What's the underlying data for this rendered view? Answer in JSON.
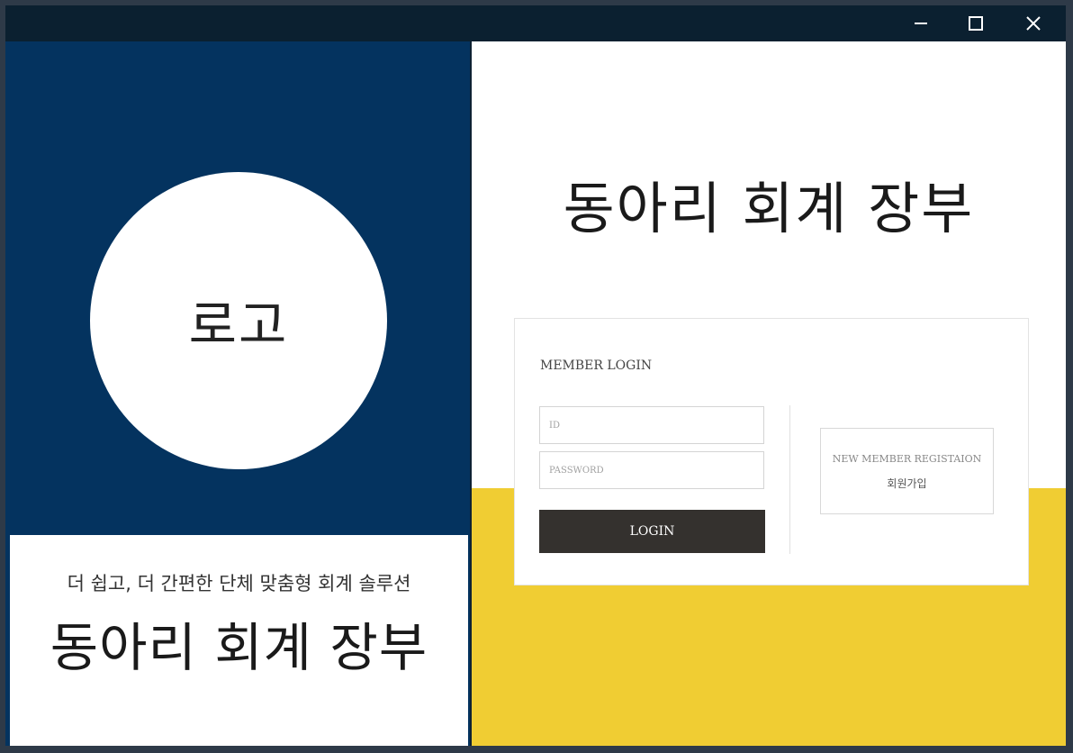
{
  "window": {
    "controls": {
      "minimize_icon": "minimize-icon",
      "maximize_icon": "maximize-icon",
      "close_icon": "close-icon"
    }
  },
  "left": {
    "logo_text": "로고",
    "tagline_sub": "더 쉽고, 더 간편한 단체 맞춤형 회계 솔루션",
    "tagline_main": "동아리 회계 장부"
  },
  "right": {
    "title": "동아리 회계 장부",
    "login": {
      "heading": "MEMBER LOGIN",
      "id_placeholder": "ID",
      "password_placeholder": "PASSWORD",
      "button_label": "LOGIN"
    },
    "register": {
      "label_en": "NEW MEMBER REGISTAION",
      "label_ko": "회원가입"
    }
  },
  "colors": {
    "left_bg": "#04335f",
    "accent_yellow": "#f0cd33",
    "login_button": "#34312e",
    "titlebar": "#0b2030"
  }
}
